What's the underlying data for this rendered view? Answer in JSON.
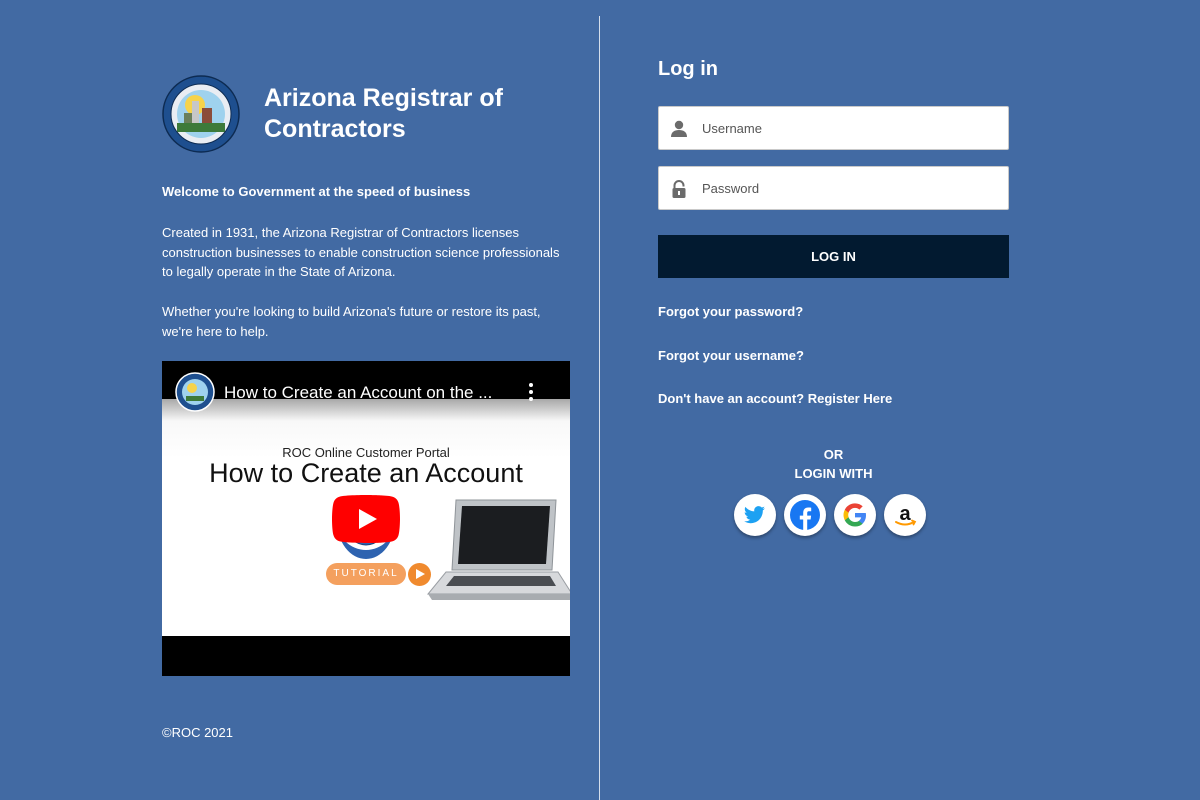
{
  "org": {
    "name": "Arizona Registrar of Contractors",
    "seal_icon": "roc-seal-icon"
  },
  "intro": {
    "welcome": "Welcome to Government at the speed of business",
    "paragraph1": "Created in 1931, the Arizona Registrar of Contractors licenses construction businesses to enable construction science professionals to legally operate in the State of Arizona.",
    "paragraph2": "Whether you're looking to build Arizona's future or restore its past, we're here to help."
  },
  "video": {
    "title": "How to Create an Account on the ...",
    "subtitle": "ROC Online Customer Portal",
    "heading": "How to Create an Account",
    "tag": "TUTORIAL"
  },
  "footer": {
    "copyright": "©ROC 2021"
  },
  "login": {
    "title": "Log in",
    "username_placeholder": "Username",
    "password_placeholder": "Password",
    "button_label": "LOG IN",
    "forgot_password": "Forgot your password?",
    "forgot_username": "Forgot your username?",
    "register": "Don't have an account? Register Here",
    "or": "OR",
    "login_with": "LOGIN WITH",
    "social_providers": [
      "twitter-icon",
      "facebook-icon",
      "google-icon",
      "amazon-icon"
    ]
  },
  "colors": {
    "background": "#426aa3",
    "button": "#021a30",
    "twitter": "#1da1f2",
    "facebook": "#1877f2",
    "youtube_red": "#ff0000"
  }
}
